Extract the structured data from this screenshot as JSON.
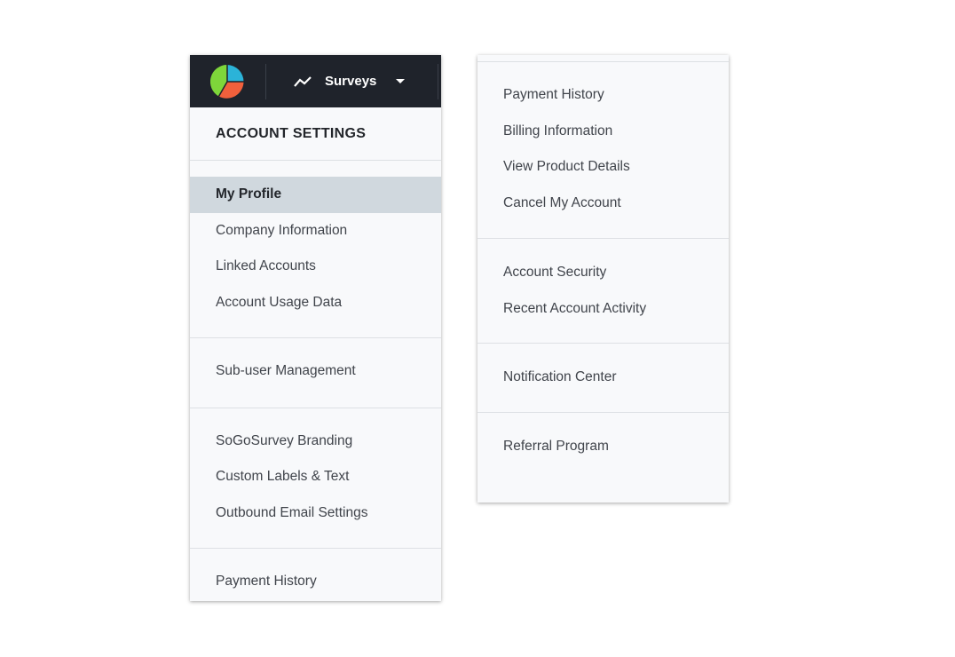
{
  "header": {
    "nav_label": "Surveys",
    "colors": {
      "bg": "#1f232b",
      "logo_blue": "#2bb3d8",
      "logo_green": "#7ed63a",
      "logo_red": "#f0603c"
    }
  },
  "left": {
    "title": "ACCOUNT SETTINGS",
    "groups": [
      [
        "My Profile",
        "Company Information",
        "Linked Accounts",
        "Account Usage Data"
      ],
      [
        "Sub-user Management"
      ],
      [
        "SoGoSurvey Branding",
        "Custom Labels & Text",
        "Outbound Email Settings"
      ],
      [
        "Payment History"
      ]
    ]
  },
  "right": {
    "groups": [
      [
        "Payment History",
        "Billing Information",
        "View Product Details",
        "Cancel My Account"
      ],
      [
        "Account Security",
        "Recent Account Activity"
      ],
      [
        "Notification Center"
      ],
      [
        "Referral Program"
      ]
    ]
  }
}
